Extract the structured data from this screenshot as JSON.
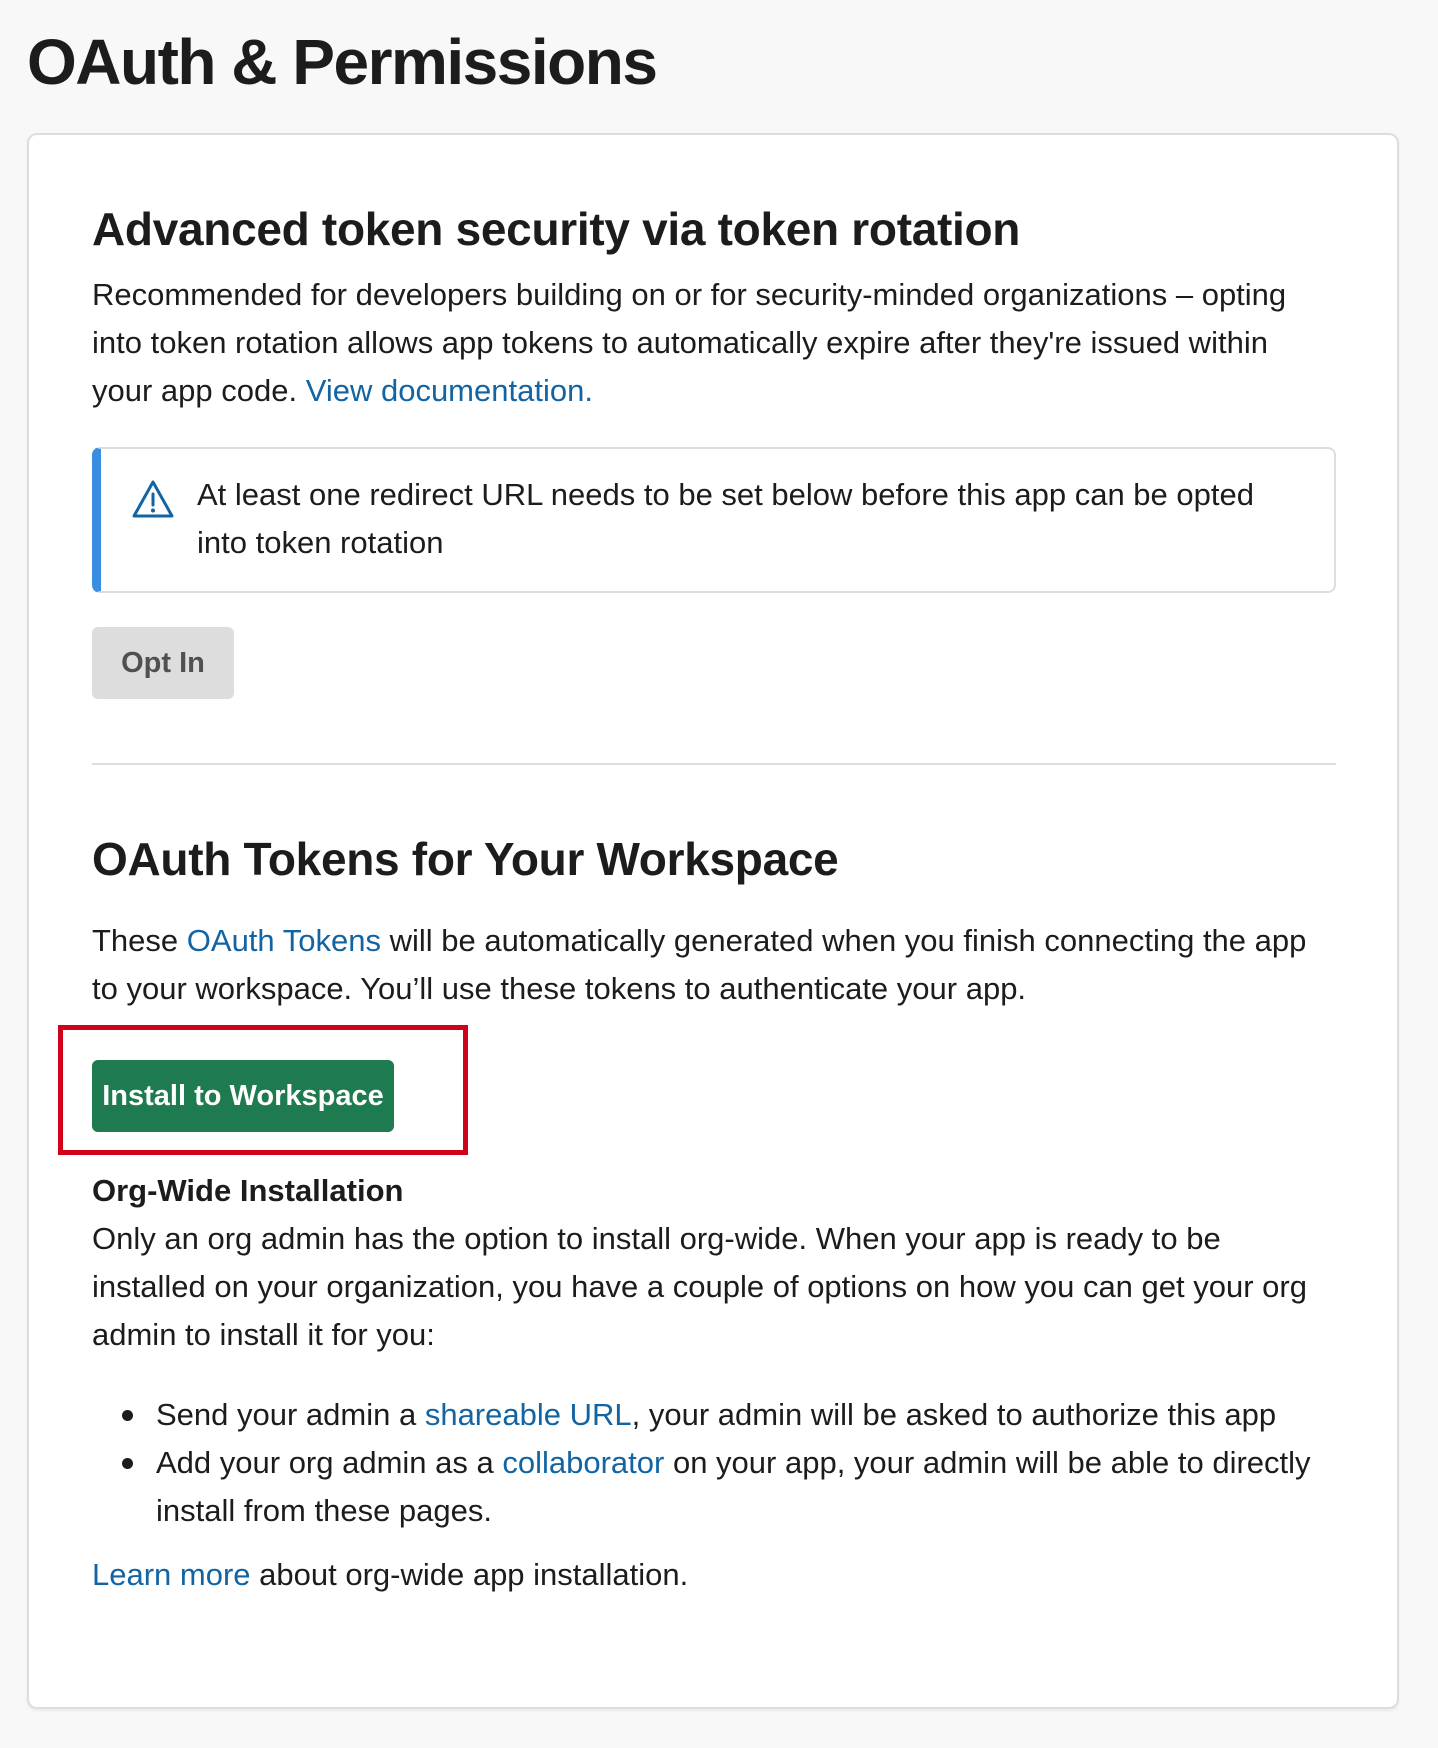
{
  "page": {
    "title": "OAuth & Permissions"
  },
  "token_rotation": {
    "title": "Advanced token security via token rotation",
    "description": "Recommended for developers building on or for security-minded organizations – opting into token rotation allows app tokens to automatically expire after they're issued within your app code.",
    "doc_link": "View documentation.",
    "alert": {
      "icon": "warning-triangle-icon",
      "text": "At least one redirect URL needs to be set below before this app can be opted into token rotation",
      "accent_color": "#3a8ee0"
    },
    "opt_in_label": "Opt In"
  },
  "oauth_tokens": {
    "title": "OAuth Tokens for Your Workspace",
    "desc_prefix": "These ",
    "desc_link": "OAuth Tokens",
    "desc_suffix": " will be automatically generated when you finish connecting the app to your workspace. You’ll use these tokens to authenticate your app.",
    "install_label": "Install to Workspace",
    "install_color": "#1e7a4f",
    "highlight_color": "#d0021b"
  },
  "org_wide": {
    "title": "Org-Wide Installation",
    "description": "Only an org admin has the option to install org-wide. When your app is ready to be installed on your organization, you have a couple of options on how you can get your org admin to install it for you:",
    "bullets": [
      {
        "prefix": "Send your admin a ",
        "link": "shareable URL",
        "suffix": ", your admin will be asked to authorize this app"
      },
      {
        "prefix": "Add your org admin as a ",
        "link": "collaborator",
        "suffix": " on your app, your admin will be able to directly install from these pages."
      }
    ],
    "learn_link": "Learn more",
    "learn_suffix": " about org-wide app installation."
  },
  "colors": {
    "link": "#1264a3",
    "text": "#1d1c1d",
    "background": "#f8f8f8"
  }
}
